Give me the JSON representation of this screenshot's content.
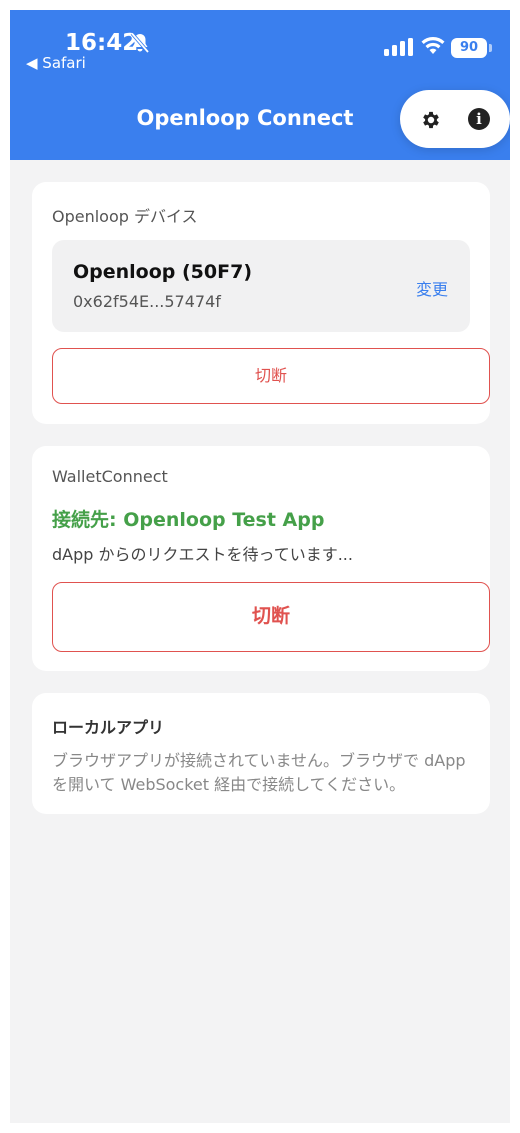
{
  "status_bar": {
    "time": "16:42",
    "back_label": "◀ Safari",
    "battery": "90"
  },
  "header": {
    "title": "Openloop Connect",
    "settings_icon": "gear-icon",
    "info_icon": "info-icon"
  },
  "device_card": {
    "title": "Openloop デバイス",
    "device_name": "Openloop (50F7)",
    "device_address": "0x62f54E...57474f",
    "change_label": "変更",
    "disconnect_label": "切断"
  },
  "walletconnect_card": {
    "title": "WalletConnect",
    "status": "接続先: Openloop Test App",
    "waiting_text": "dApp からのリクエストを待っています...",
    "disconnect_label": "切断"
  },
  "local_apps_card": {
    "title": "ローカルアプリ",
    "message": "ブラウザアプリが接続されていません。ブラウザで dApp を開いて WebSocket 経由で接続してください。"
  },
  "colors": {
    "accent": "#3a7fee",
    "danger": "#e0524f",
    "success": "#45a049"
  }
}
